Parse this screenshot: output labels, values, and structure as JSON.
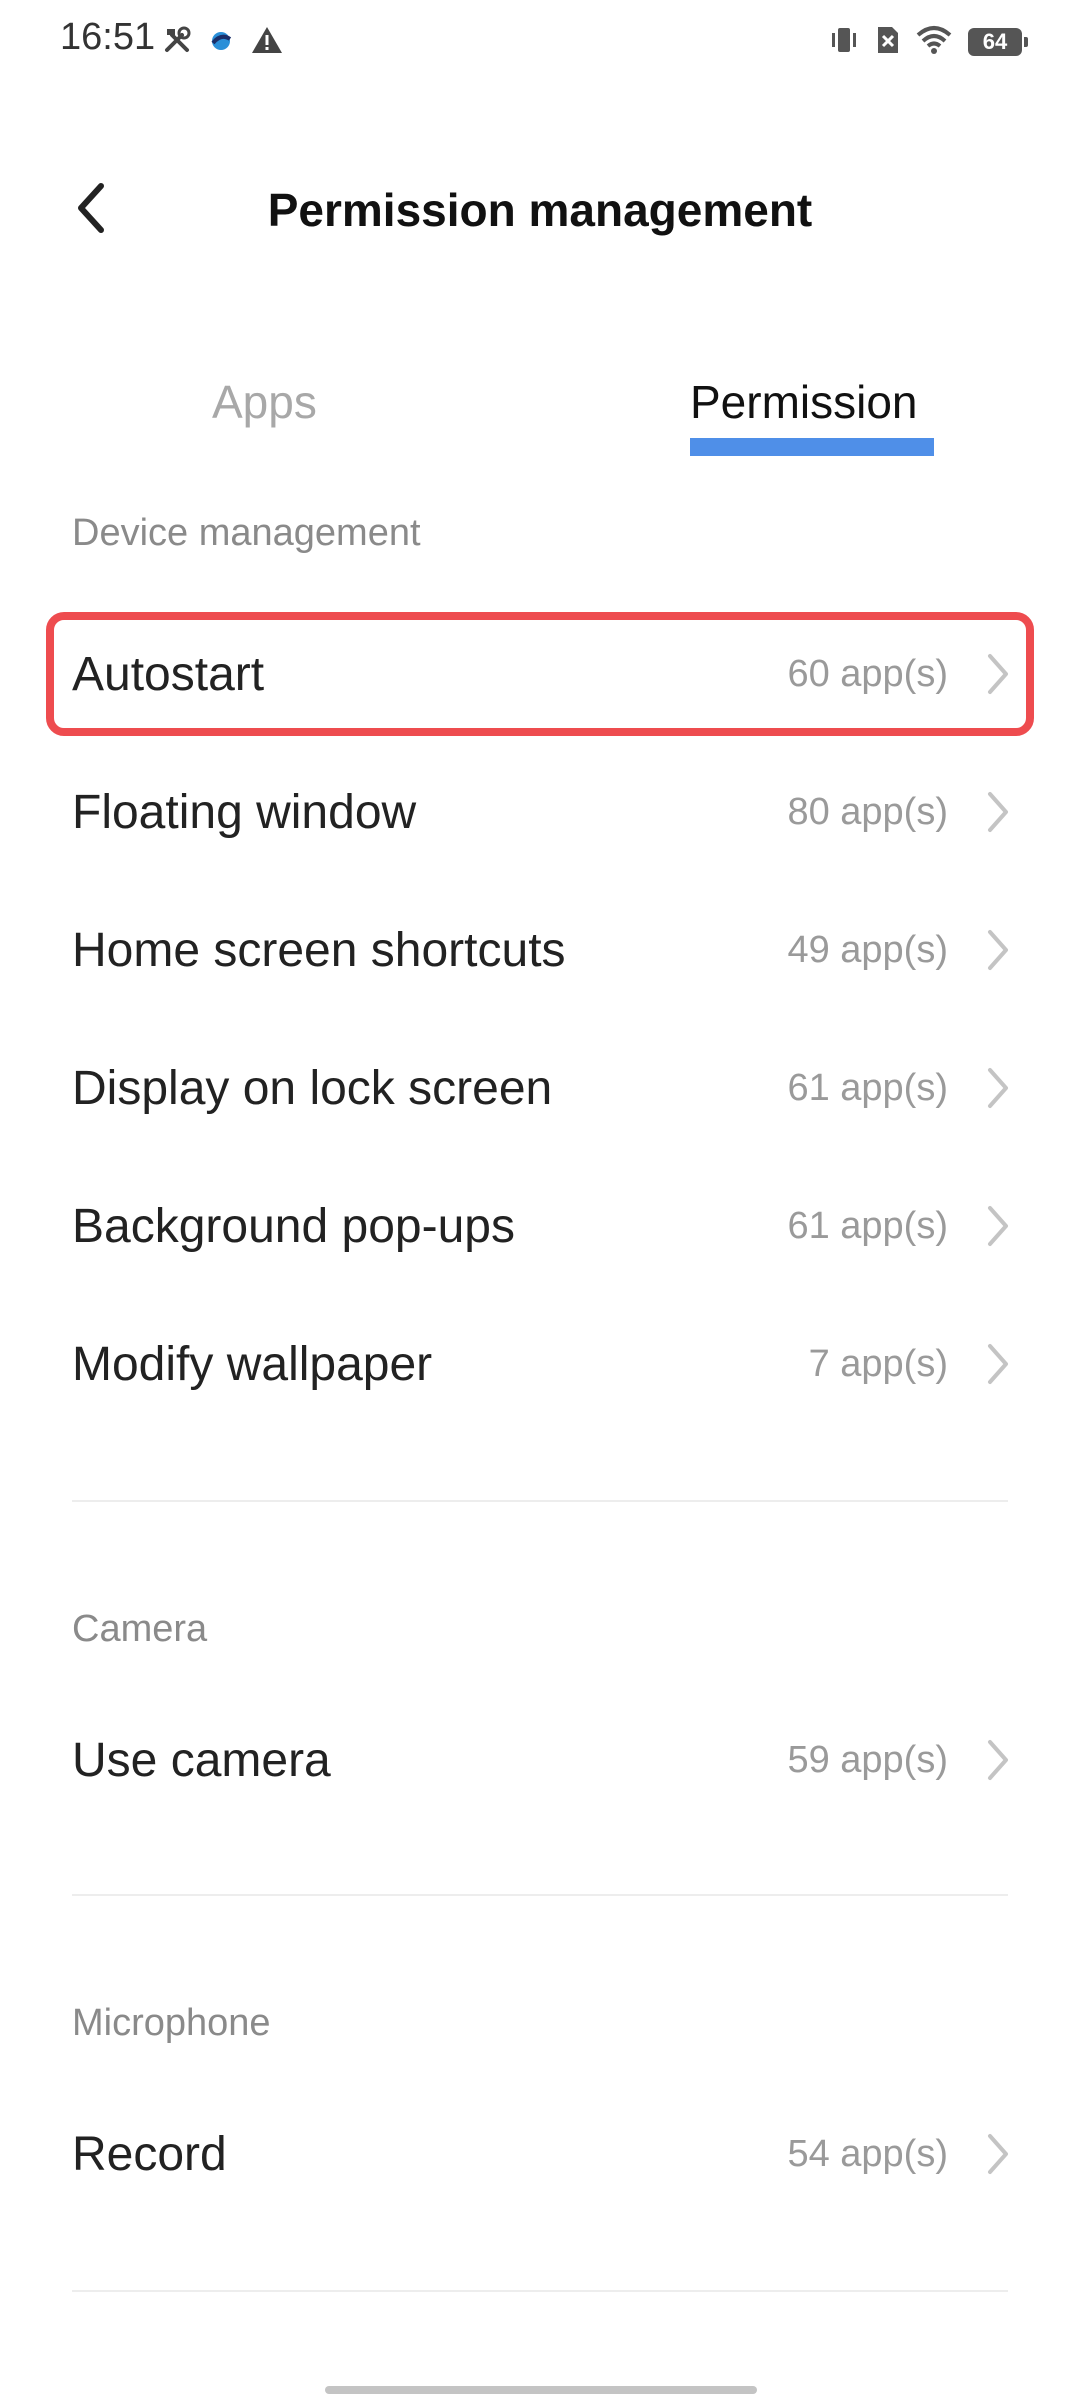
{
  "status_bar": {
    "time": "16:51",
    "left_icons": [
      "tools-icon",
      "app-notification-icon",
      "warning-icon"
    ],
    "right_icons": [
      "vibrate-icon",
      "no-sim-icon",
      "wifi-icon"
    ],
    "battery": "64"
  },
  "header": {
    "title": "Permission management",
    "back_icon": "chevron-left-icon"
  },
  "tabs": [
    {
      "label": "Apps",
      "selected": false
    },
    {
      "label": "Permission",
      "selected": true
    }
  ],
  "colors": {
    "accent": "#4f8fe8",
    "highlight": "#ee4c4f",
    "section_text": "#8a8a8a",
    "count_text": "#9a9a9a"
  },
  "sections": [
    {
      "header": "Device management",
      "items": [
        {
          "label": "Autostart",
          "count": "60 app(s)",
          "highlighted": true
        },
        {
          "label": "Floating window",
          "count": "80 app(s)"
        },
        {
          "label": "Home screen shortcuts",
          "count": "49 app(s)"
        },
        {
          "label": "Display on lock screen",
          "count": "61 app(s)"
        },
        {
          "label": "Background pop-ups",
          "count": "61 app(s)"
        },
        {
          "label": "Modify wallpaper",
          "count": "7 app(s)"
        }
      ]
    },
    {
      "header": "Camera",
      "items": [
        {
          "label": "Use camera",
          "count": "59 app(s)"
        }
      ]
    },
    {
      "header": "Microphone",
      "items": [
        {
          "label": "Record",
          "count": "54 app(s)"
        }
      ]
    }
  ]
}
